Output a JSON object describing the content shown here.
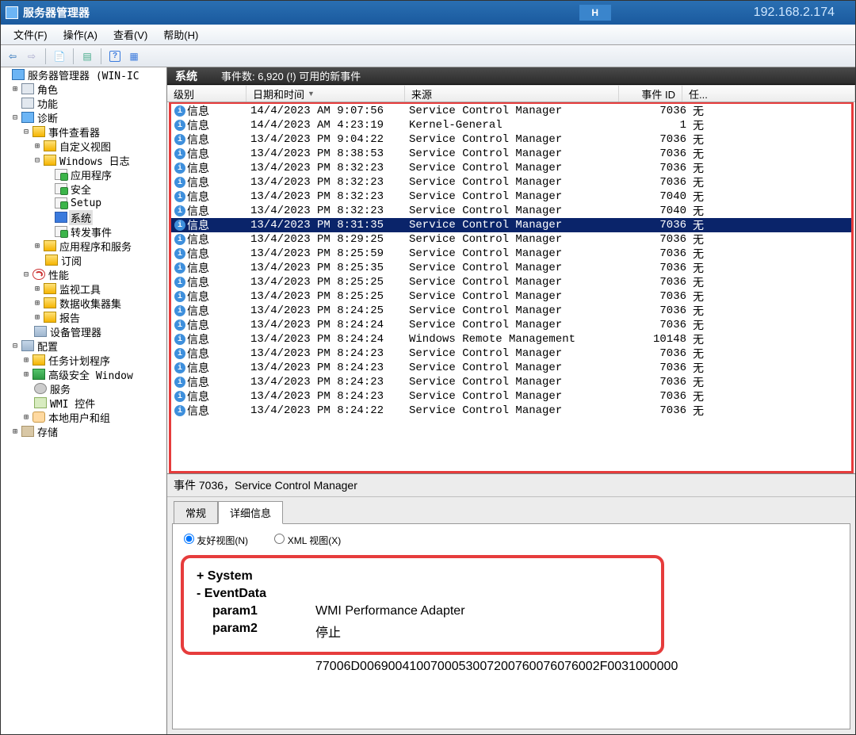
{
  "title_bar": {
    "title": "服务器管理器",
    "badge": "H",
    "ip": "192.168.2.174"
  },
  "menu": {
    "file": "文件(F)",
    "action": "操作(A)",
    "view": "查看(V)",
    "help": "帮助(H)"
  },
  "tree": {
    "root": "服务器管理器 (WIN-IC",
    "roles": "角色",
    "features": "功能",
    "diagnostics": "诊断",
    "event_viewer": "事件查看器",
    "custom_views": "自定义视图",
    "windows_logs": "Windows 日志",
    "application": "应用程序",
    "security": "安全",
    "setup": "Setup",
    "system": "系统",
    "forwarded": "转发事件",
    "apps_and_services": "应用程序和服务",
    "subscriptions": "订阅",
    "performance": "性能",
    "monitoring_tools": "监视工具",
    "data_collector_sets": "数据收集器集",
    "reports": "报告",
    "device_manager": "设备管理器",
    "configuration": "配置",
    "task_scheduler": "任务计划程序",
    "advanced_firewall": "高级安全 Window",
    "services": "服务",
    "wmi_control": "WMI 控件",
    "local_users": "本地用户和组",
    "storage": "存储"
  },
  "right_header": {
    "title": "系统",
    "events_label": "事件数: 6,920 (!) 可用的新事件"
  },
  "columns": {
    "level": "级别",
    "datetime": "日期和时间",
    "source": "来源",
    "event_id": "事件 ID",
    "task": "任..."
  },
  "rows": [
    {
      "level": "信息",
      "dt": "14/4/2023 AM 9:07:56",
      "src": "Service Control Manager",
      "id": "7036",
      "task": "无",
      "sel": false
    },
    {
      "level": "信息",
      "dt": "14/4/2023 AM 4:23:19",
      "src": "Kernel-General",
      "id": "1",
      "task": "无",
      "sel": false
    },
    {
      "level": "信息",
      "dt": "13/4/2023 PM 9:04:22",
      "src": "Service Control Manager",
      "id": "7036",
      "task": "无",
      "sel": false
    },
    {
      "level": "信息",
      "dt": "13/4/2023 PM 8:38:53",
      "src": "Service Control Manager",
      "id": "7036",
      "task": "无",
      "sel": false
    },
    {
      "level": "信息",
      "dt": "13/4/2023 PM 8:32:23",
      "src": "Service Control Manager",
      "id": "7036",
      "task": "无",
      "sel": false
    },
    {
      "level": "信息",
      "dt": "13/4/2023 PM 8:32:23",
      "src": "Service Control Manager",
      "id": "7036",
      "task": "无",
      "sel": false
    },
    {
      "level": "信息",
      "dt": "13/4/2023 PM 8:32:23",
      "src": "Service Control Manager",
      "id": "7040",
      "task": "无",
      "sel": false
    },
    {
      "level": "信息",
      "dt": "13/4/2023 PM 8:32:23",
      "src": "Service Control Manager",
      "id": "7040",
      "task": "无",
      "sel": false
    },
    {
      "level": "信息",
      "dt": "13/4/2023 PM 8:31:35",
      "src": "Service Control Manager",
      "id": "7036",
      "task": "无",
      "sel": true
    },
    {
      "level": "信息",
      "dt": "13/4/2023 PM 8:29:25",
      "src": "Service Control Manager",
      "id": "7036",
      "task": "无",
      "sel": false
    },
    {
      "level": "信息",
      "dt": "13/4/2023 PM 8:25:59",
      "src": "Service Control Manager",
      "id": "7036",
      "task": "无",
      "sel": false
    },
    {
      "level": "信息",
      "dt": "13/4/2023 PM 8:25:35",
      "src": "Service Control Manager",
      "id": "7036",
      "task": "无",
      "sel": false
    },
    {
      "level": "信息",
      "dt": "13/4/2023 PM 8:25:25",
      "src": "Service Control Manager",
      "id": "7036",
      "task": "无",
      "sel": false
    },
    {
      "level": "信息",
      "dt": "13/4/2023 PM 8:25:25",
      "src": "Service Control Manager",
      "id": "7036",
      "task": "无",
      "sel": false
    },
    {
      "level": "信息",
      "dt": "13/4/2023 PM 8:24:25",
      "src": "Service Control Manager",
      "id": "7036",
      "task": "无",
      "sel": false
    },
    {
      "level": "信息",
      "dt": "13/4/2023 PM 8:24:24",
      "src": "Service Control Manager",
      "id": "7036",
      "task": "无",
      "sel": false
    },
    {
      "level": "信息",
      "dt": "13/4/2023 PM 8:24:24",
      "src": "Windows Remote Management",
      "id": "10148",
      "task": "无",
      "sel": false
    },
    {
      "level": "信息",
      "dt": "13/4/2023 PM 8:24:23",
      "src": "Service Control Manager",
      "id": "7036",
      "task": "无",
      "sel": false
    },
    {
      "level": "信息",
      "dt": "13/4/2023 PM 8:24:23",
      "src": "Service Control Manager",
      "id": "7036",
      "task": "无",
      "sel": false
    },
    {
      "level": "信息",
      "dt": "13/4/2023 PM 8:24:23",
      "src": "Service Control Manager",
      "id": "7036",
      "task": "无",
      "sel": false
    },
    {
      "level": "信息",
      "dt": "13/4/2023 PM 8:24:23",
      "src": "Service Control Manager",
      "id": "7036",
      "task": "无",
      "sel": false
    },
    {
      "level": "信息",
      "dt": "13/4/2023 PM 8:24:22",
      "src": "Service Control Manager",
      "id": "7036",
      "task": "无",
      "sel": false
    }
  ],
  "detail": {
    "title": "事件 7036，Service Control Manager",
    "tab_general": "常规",
    "tab_details": "详细信息",
    "radio_friendly": "友好视图(N)",
    "radio_xml": "XML 视图(X)",
    "system_node": "System",
    "eventdata_node": "EventData",
    "param1_label": "param1",
    "param1_value": "WMI Performance Adapter",
    "param2_label": "param2",
    "param2_value": "停止",
    "binary": "77006D0069004100700053007200760076076002F0031000000"
  }
}
